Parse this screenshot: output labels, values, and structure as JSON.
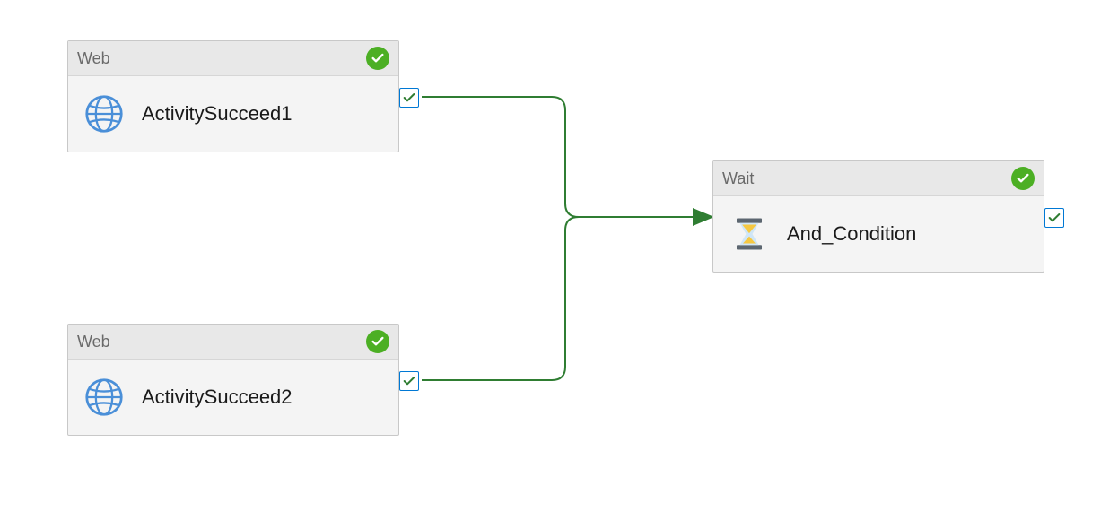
{
  "nodes": {
    "activity1": {
      "type_label": "Web",
      "name": "ActivitySucceed1",
      "icon": "globe-icon",
      "status": "success"
    },
    "activity2": {
      "type_label": "Web",
      "name": "ActivitySucceed2",
      "icon": "globe-icon",
      "status": "success"
    },
    "wait": {
      "type_label": "Wait",
      "name": "And_Condition",
      "icon": "hourglass-icon",
      "status": "success"
    }
  },
  "colors": {
    "success_green": "#4caf24",
    "port_border": "#0078d4",
    "edge_stroke": "#2f7d32",
    "globe_blue": "#4a8fd8",
    "hourglass_frame": "#5c6670",
    "hourglass_sand": "#f5c842"
  }
}
